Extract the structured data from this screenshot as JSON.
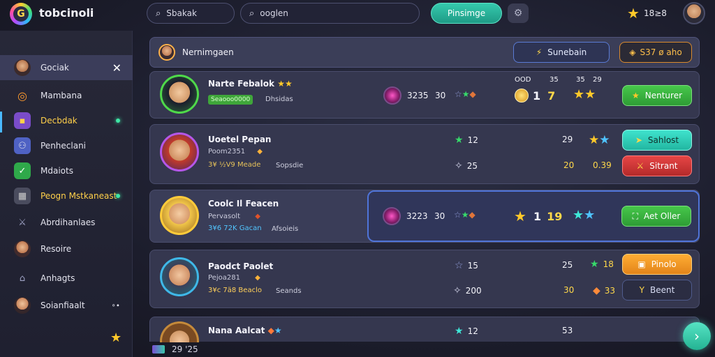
{
  "topbar": {
    "app_title": "tobcinoli",
    "search1_label": "Sbakak",
    "search2_label": "ooglen",
    "pill_button": "Pinsimge",
    "star_total": "18≥8",
    "icons": {
      "logo": "G",
      "search": "search-icon",
      "settings": "gear-icon",
      "star": "star-icon"
    }
  },
  "sidebar": {
    "items": [
      {
        "label": "Gociak",
        "active": true,
        "close": "✕"
      },
      {
        "label": "Mambana"
      },
      {
        "label": "Decbdak"
      },
      {
        "label": "Penheclani"
      },
      {
        "label": "Mdaiots"
      },
      {
        "label": "Peogn Mstkaneast"
      },
      {
        "label": "Abrdihanlaes"
      },
      {
        "label": "Resoire"
      },
      {
        "label": "Anhagts"
      },
      {
        "label": "Soianfiaalt"
      }
    ]
  },
  "header": {
    "title": "Nernimgaen",
    "blue_button": "Sunebain",
    "orange_button": "S37 ø aho"
  },
  "rows": [
    {
      "name": "Narte Febalok",
      "badge": "Seaooo0000",
      "tag": "Dhsidas",
      "stat_a": "3235",
      "stat_b": "30",
      "col_headers": [
        "OOD",
        "35",
        "35",
        "29"
      ],
      "val1": "1",
      "val2": "7",
      "action": "Nenturer"
    },
    {
      "name": "Uoetel Pepan",
      "sub": "Poom2351",
      "sub2": "3¥ ½V9 Meade",
      "tag": "Sopsdie",
      "v1": "12",
      "v2": "25",
      "v3": "29",
      "v4": "20",
      "v5": "0.39",
      "action1": "Sahlost",
      "action2": "Sitrant"
    },
    {
      "name": "Coolc Il Feacen",
      "sub": "Pervasolt",
      "sub2": "3¥6 72K Gacan",
      "tag": "Afsoieis",
      "stat_a": "3223",
      "stat_b": "30",
      "val1": "1",
      "val2": "19",
      "action": "Aet Oller"
    },
    {
      "name": "Paodct Paolet",
      "sub": "Pejoa281",
      "sub2": "3¥c 7ä8 Beaclo",
      "tag": "Seands",
      "v1": "15",
      "v2": "25",
      "v3": "18",
      "v4": "200",
      "v5": "30",
      "v6": "33",
      "action1": "Pinolo",
      "action2": "Beent"
    },
    {
      "name": "Nana Aalcat",
      "v1": "12",
      "v2": "53"
    }
  ],
  "footer": {
    "value": "29 '25"
  },
  "colors": {
    "accent_teal": "#35c9ad",
    "green": "#46c74a",
    "red": "#e64545",
    "orange": "#ffad34",
    "gold": "#ffc92a"
  }
}
